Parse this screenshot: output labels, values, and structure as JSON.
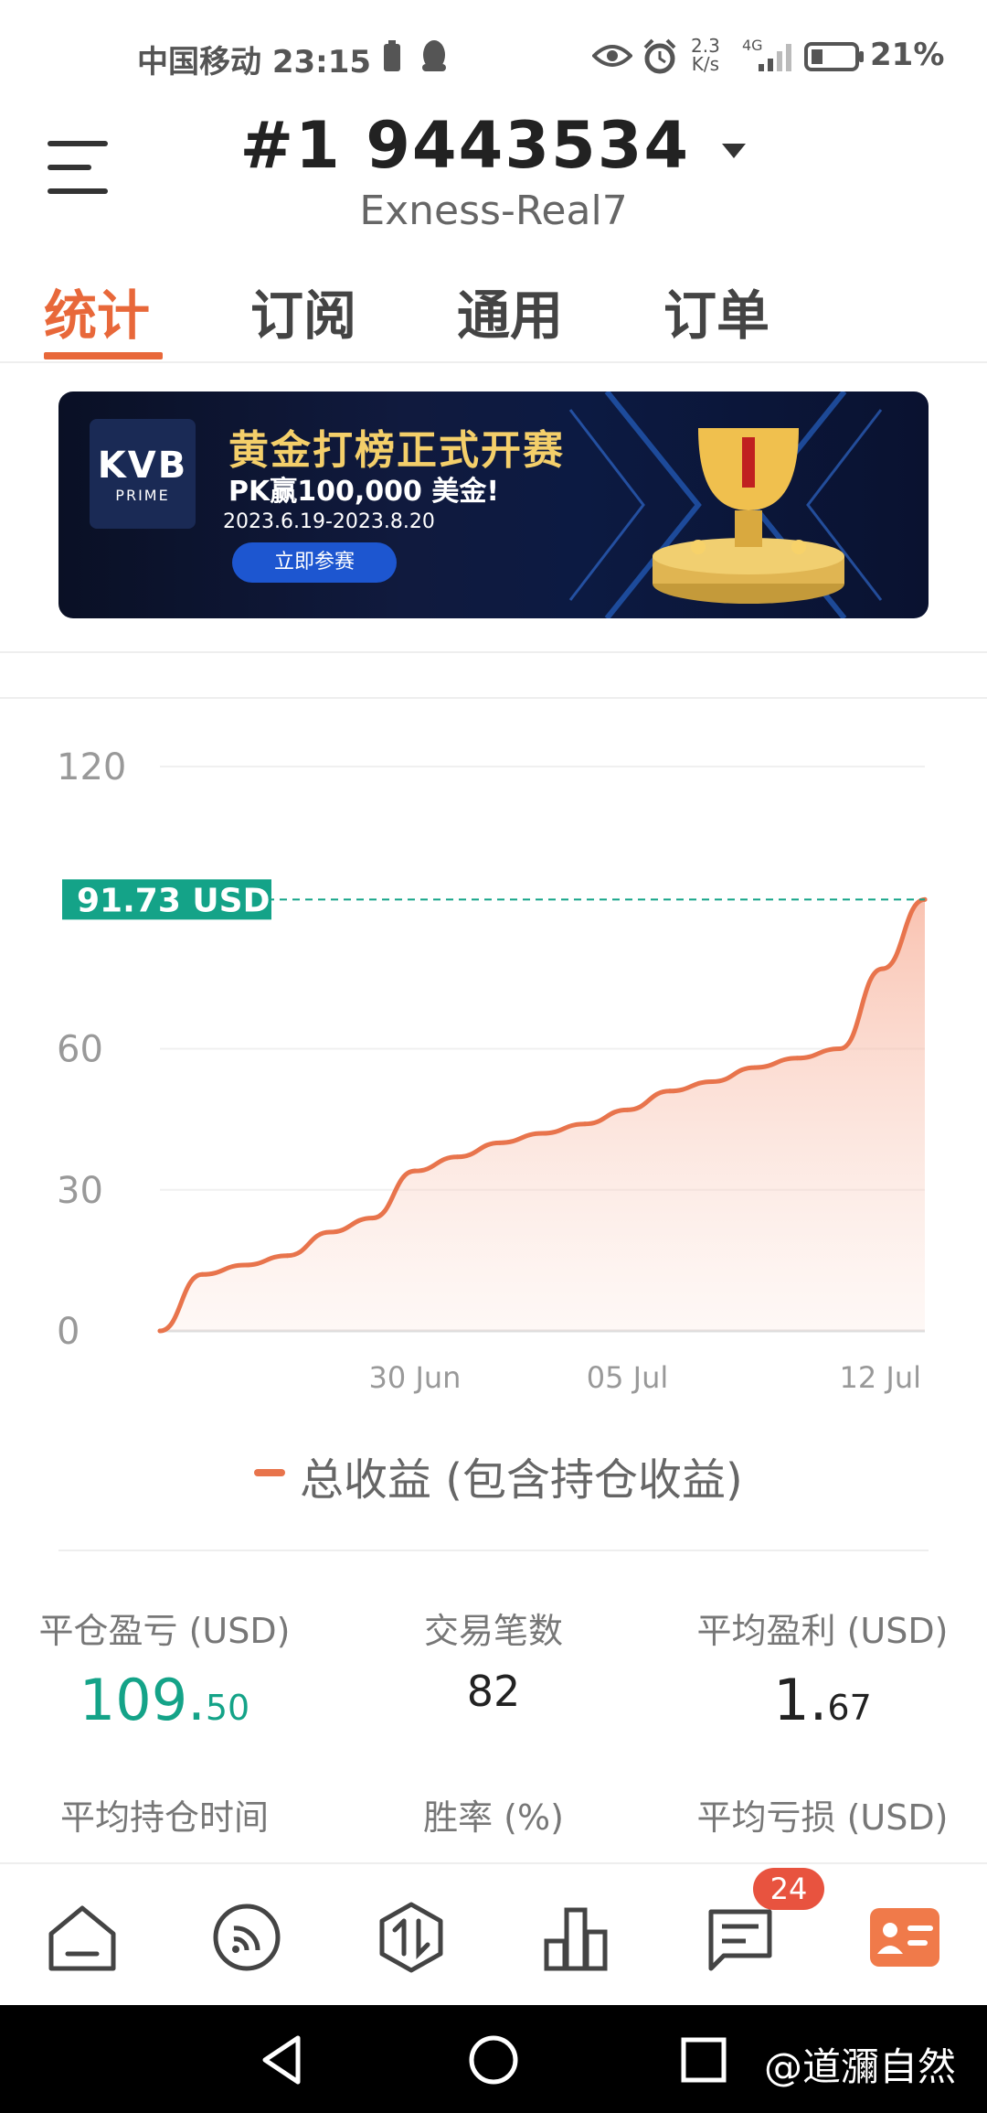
{
  "status_bar": {
    "carrier_time": "中国移动 23:15",
    "net_speed_top": "2.3",
    "net_speed_bottom": "K/s",
    "signal": "4G",
    "battery": "21%"
  },
  "header": {
    "account_number": "#1  9443534",
    "server": "Exness-Real7"
  },
  "tabs": [
    {
      "label": "统计",
      "active": true
    },
    {
      "label": "订阅",
      "active": false
    },
    {
      "label": "通用",
      "active": false
    },
    {
      "label": "订单",
      "active": false
    }
  ],
  "banner": {
    "logo_top": "KVB",
    "logo_bottom": "PRIME",
    "title": "黄金打榜正式开赛",
    "subtitle": "PK赢100,000 美金!",
    "dates": "2023.6.19-2023.8.20",
    "cta": "立即参赛"
  },
  "chart_data": {
    "type": "area",
    "series": [
      {
        "name": "总收益 (包含持仓收益)",
        "color": "#e8744c",
        "x": [
          "2023-06-24",
          "2023-06-25",
          "2023-06-26",
          "2023-06-27",
          "2023-06-28",
          "2023-06-29",
          "2023-06-30",
          "2023-07-01",
          "2023-07-02",
          "2023-07-03",
          "2023-07-04",
          "2023-07-05",
          "2023-07-06",
          "2023-07-07",
          "2023-07-08",
          "2023-07-09",
          "2023-07-10",
          "2023-07-11",
          "2023-07-12"
        ],
        "y": [
          0,
          12,
          14,
          16,
          21,
          24,
          34,
          37,
          40,
          42,
          44,
          47,
          51,
          53,
          56,
          58,
          60,
          77,
          91.73
        ]
      }
    ],
    "x_ticks": [
      "30 Jun",
      "05 Jul",
      "12 Jul"
    ],
    "y_ticks": [
      "0",
      "30",
      "60",
      "120"
    ],
    "ylim": [
      0,
      120
    ],
    "current_value_label": "91.73 USD",
    "current_value": 91.73,
    "current_value_color": "#14a388",
    "legend": "总收益 (包含持仓收益)",
    "grid": true
  },
  "stats": [
    {
      "label": "平仓盈亏 (USD)",
      "value_int": "109.",
      "value_dec": "50",
      "color": "#14a388"
    },
    {
      "label": "交易笔数",
      "value_int": "82",
      "value_dec": "",
      "color": "#222222"
    },
    {
      "label": "平均盈利 (USD)",
      "value_int": "1.",
      "value_dec": "67",
      "color": "#222222"
    },
    {
      "label": "平均持仓时间"
    },
    {
      "label": "胜率 (%)"
    },
    {
      "label": "平均亏损 (USD)"
    }
  ],
  "bottom_nav": {
    "items": [
      "home-icon",
      "feed-icon",
      "trade-icon",
      "chart-icon",
      "messages-icon",
      "profile-icon"
    ],
    "badge": "24",
    "accent": "#f07a4a"
  },
  "watermark": "@道瀰自然"
}
